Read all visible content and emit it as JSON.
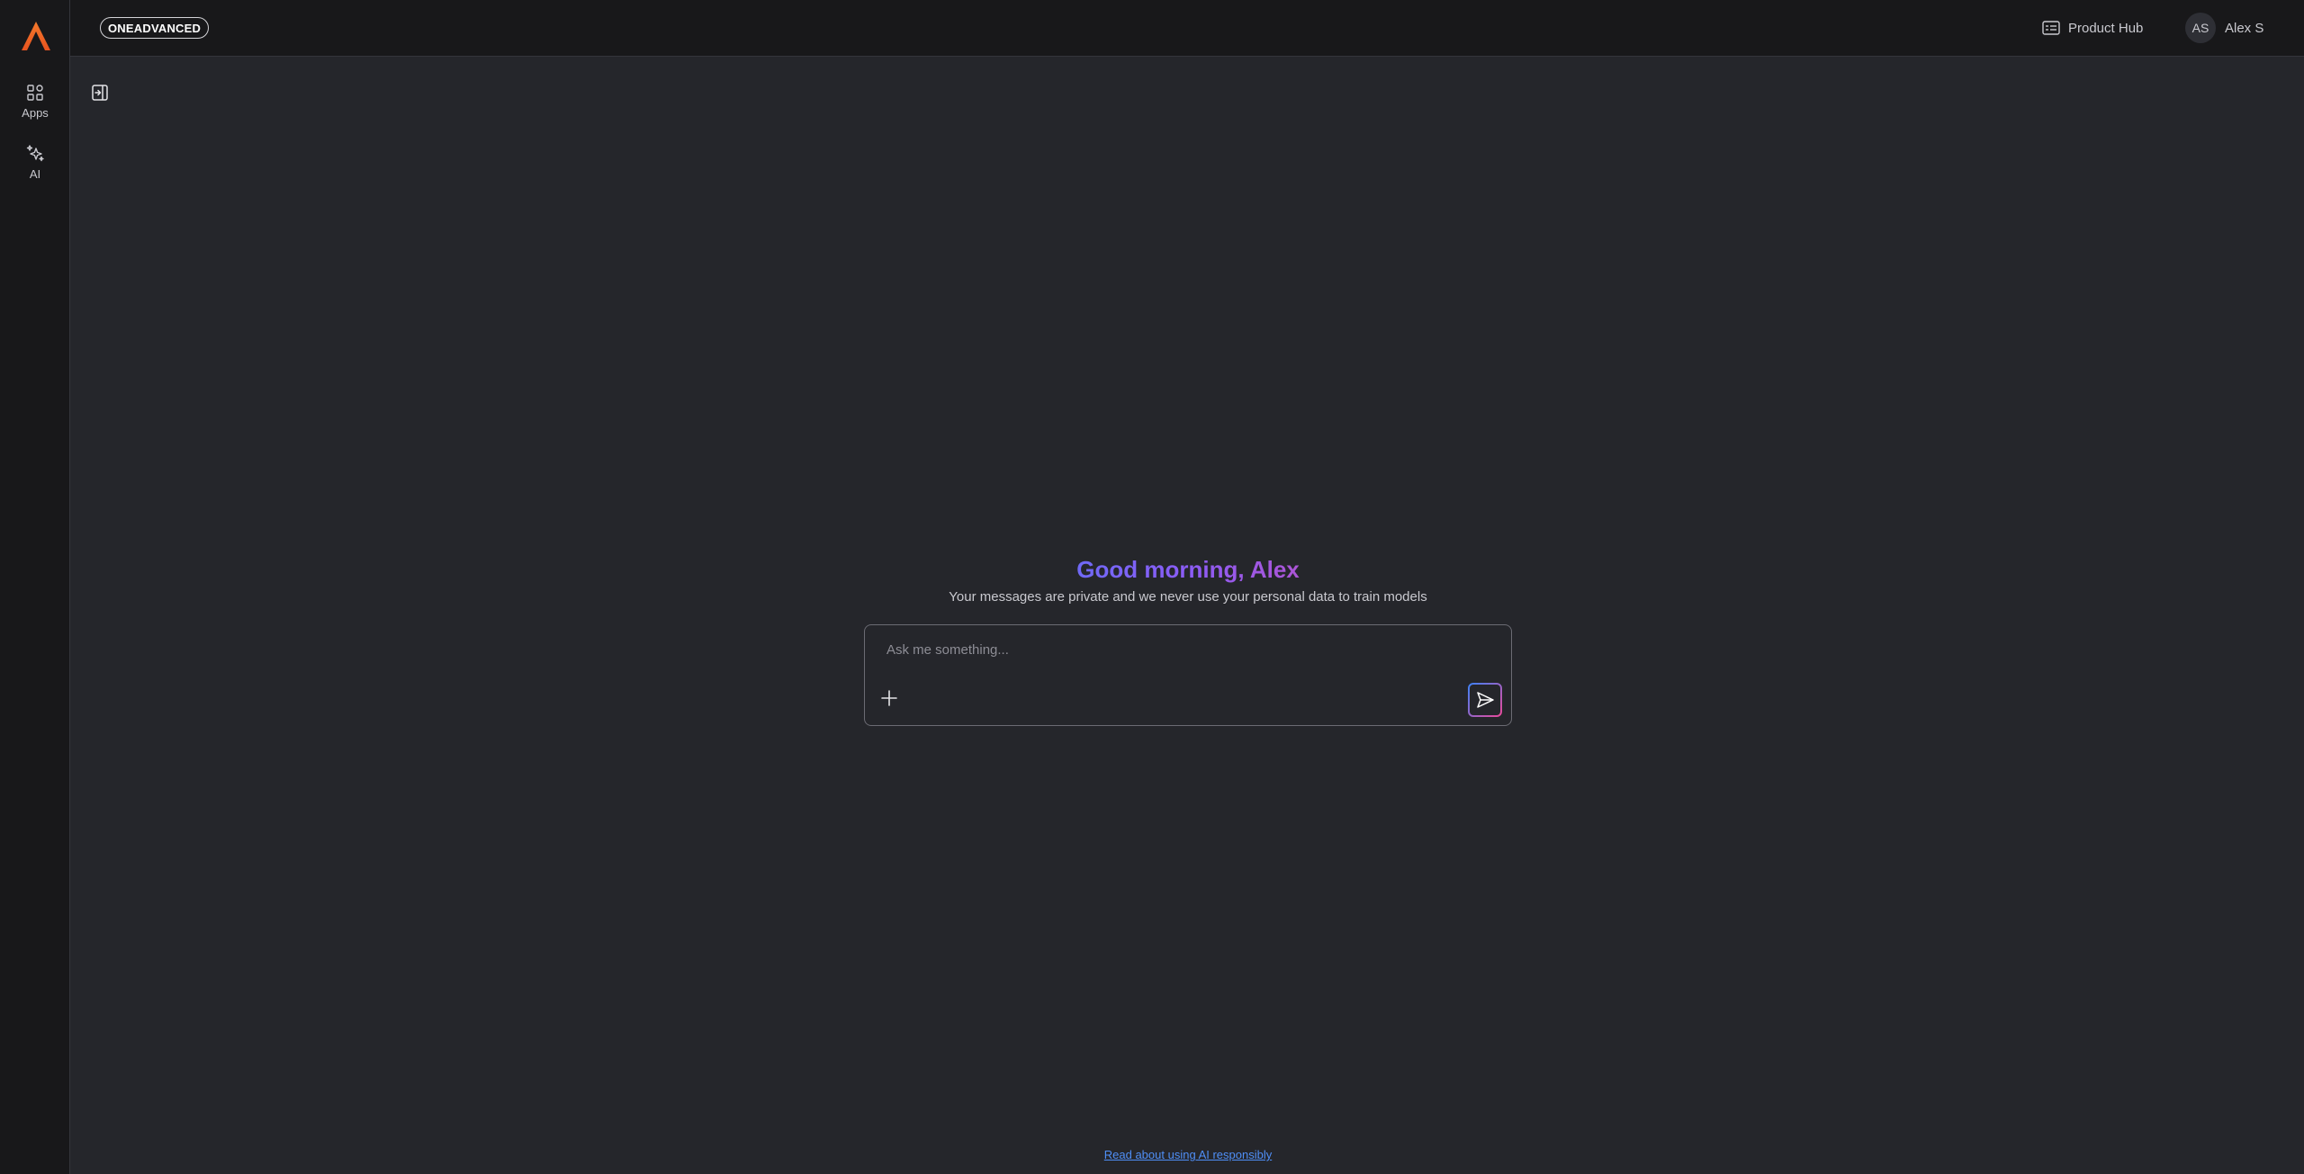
{
  "rail": {
    "logo_icon": "oneadvanced-logo-icon",
    "items": [
      {
        "label": "Apps",
        "icon": "grid-apps-icon"
      },
      {
        "label": "AI",
        "icon": "sparkles-icon"
      }
    ]
  },
  "topbar": {
    "brand": "ONEADVANCED",
    "product_hub": {
      "label": "Product Hub",
      "icon": "product-hub-icon"
    },
    "user": {
      "initials": "AS",
      "name": "Alex S"
    }
  },
  "main": {
    "greeting": "Good morning, Alex",
    "privacy_note": "Your messages are private and we never use your personal data to train models",
    "chat": {
      "placeholder": "Ask me something...",
      "value": "",
      "add_icon": "plus-icon",
      "send_icon": "send-icon"
    },
    "footer_link": "Read about using AI responsibly"
  },
  "colors": {
    "background": "#25262b",
    "rail_bg": "#18181a",
    "logo_orange": "#f26b2a",
    "gradient_start": "#3b82f6",
    "gradient_mid": "#8b5cf6",
    "gradient_end": "#ec4899",
    "link": "#4f8ff7"
  }
}
